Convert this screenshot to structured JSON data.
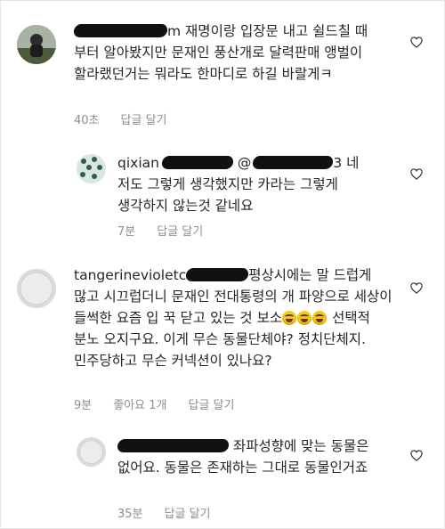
{
  "comments": [
    {
      "text": "재명이랑 입장문 내고 쉴드칠 때 부터 알아봤지만 문재인 풍산개로 달력판매 앵벌이 할라랬던거는 뭐라도 한마디로 하길 바랄게ㅋ",
      "username_visible": "m",
      "time": "40초",
      "reply": "답글 달기"
    },
    {
      "username_visible": "qixian",
      "text_head": "@",
      "text_tail": "3 네 저도 그렇게 생각했지만 카라는 그렇게 생각하지 않는것 같네요",
      "time": "7분",
      "reply": "답글 달기"
    },
    {
      "username_visible": "tangerinevioletc",
      "text_a": "평상시에는 말 드럽게 많고 시끄럽더니 문재인 전대통령의 개 파양으로 세상이 들썩한 요즘 입 꾹 닫고 있는 것 보소",
      "text_b": "선택적 분노 오지구요. 이게 무슨 동물단체야? 정치단체지. 민주당하고 무슨 커넥션이 있나요?",
      "time": "9분",
      "likes": "좋아요 1개",
      "reply": "답글 달기"
    },
    {
      "text": "좌파성향에 맞는 동물은 없어요. 동물은 존재하는 그대로 동물인거죠",
      "time": "35분",
      "reply": "답글 달기"
    }
  ]
}
